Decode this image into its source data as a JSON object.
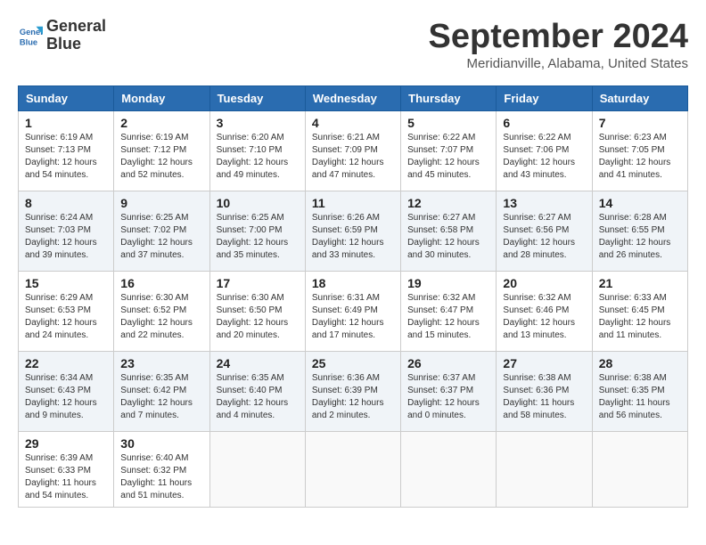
{
  "header": {
    "logo_line1": "General",
    "logo_line2": "Blue",
    "month": "September 2024",
    "location": "Meridianville, Alabama, United States"
  },
  "days_of_week": [
    "Sunday",
    "Monday",
    "Tuesday",
    "Wednesday",
    "Thursday",
    "Friday",
    "Saturday"
  ],
  "weeks": [
    [
      {
        "day": "1",
        "sunrise": "6:19 AM",
        "sunset": "7:13 PM",
        "daylight": "12 hours and 54 minutes."
      },
      {
        "day": "2",
        "sunrise": "6:19 AM",
        "sunset": "7:12 PM",
        "daylight": "12 hours and 52 minutes."
      },
      {
        "day": "3",
        "sunrise": "6:20 AM",
        "sunset": "7:10 PM",
        "daylight": "12 hours and 49 minutes."
      },
      {
        "day": "4",
        "sunrise": "6:21 AM",
        "sunset": "7:09 PM",
        "daylight": "12 hours and 47 minutes."
      },
      {
        "day": "5",
        "sunrise": "6:22 AM",
        "sunset": "7:07 PM",
        "daylight": "12 hours and 45 minutes."
      },
      {
        "day": "6",
        "sunrise": "6:22 AM",
        "sunset": "7:06 PM",
        "daylight": "12 hours and 43 minutes."
      },
      {
        "day": "7",
        "sunrise": "6:23 AM",
        "sunset": "7:05 PM",
        "daylight": "12 hours and 41 minutes."
      }
    ],
    [
      {
        "day": "8",
        "sunrise": "6:24 AM",
        "sunset": "7:03 PM",
        "daylight": "12 hours and 39 minutes."
      },
      {
        "day": "9",
        "sunrise": "6:25 AM",
        "sunset": "7:02 PM",
        "daylight": "12 hours and 37 minutes."
      },
      {
        "day": "10",
        "sunrise": "6:25 AM",
        "sunset": "7:00 PM",
        "daylight": "12 hours and 35 minutes."
      },
      {
        "day": "11",
        "sunrise": "6:26 AM",
        "sunset": "6:59 PM",
        "daylight": "12 hours and 33 minutes."
      },
      {
        "day": "12",
        "sunrise": "6:27 AM",
        "sunset": "6:58 PM",
        "daylight": "12 hours and 30 minutes."
      },
      {
        "day": "13",
        "sunrise": "6:27 AM",
        "sunset": "6:56 PM",
        "daylight": "12 hours and 28 minutes."
      },
      {
        "day": "14",
        "sunrise": "6:28 AM",
        "sunset": "6:55 PM",
        "daylight": "12 hours and 26 minutes."
      }
    ],
    [
      {
        "day": "15",
        "sunrise": "6:29 AM",
        "sunset": "6:53 PM",
        "daylight": "12 hours and 24 minutes."
      },
      {
        "day": "16",
        "sunrise": "6:30 AM",
        "sunset": "6:52 PM",
        "daylight": "12 hours and 22 minutes."
      },
      {
        "day": "17",
        "sunrise": "6:30 AM",
        "sunset": "6:50 PM",
        "daylight": "12 hours and 20 minutes."
      },
      {
        "day": "18",
        "sunrise": "6:31 AM",
        "sunset": "6:49 PM",
        "daylight": "12 hours and 17 minutes."
      },
      {
        "day": "19",
        "sunrise": "6:32 AM",
        "sunset": "6:47 PM",
        "daylight": "12 hours and 15 minutes."
      },
      {
        "day": "20",
        "sunrise": "6:32 AM",
        "sunset": "6:46 PM",
        "daylight": "12 hours and 13 minutes."
      },
      {
        "day": "21",
        "sunrise": "6:33 AM",
        "sunset": "6:45 PM",
        "daylight": "12 hours and 11 minutes."
      }
    ],
    [
      {
        "day": "22",
        "sunrise": "6:34 AM",
        "sunset": "6:43 PM",
        "daylight": "12 hours and 9 minutes."
      },
      {
        "day": "23",
        "sunrise": "6:35 AM",
        "sunset": "6:42 PM",
        "daylight": "12 hours and 7 minutes."
      },
      {
        "day": "24",
        "sunrise": "6:35 AM",
        "sunset": "6:40 PM",
        "daylight": "12 hours and 4 minutes."
      },
      {
        "day": "25",
        "sunrise": "6:36 AM",
        "sunset": "6:39 PM",
        "daylight": "12 hours and 2 minutes."
      },
      {
        "day": "26",
        "sunrise": "6:37 AM",
        "sunset": "6:37 PM",
        "daylight": "12 hours and 0 minutes."
      },
      {
        "day": "27",
        "sunrise": "6:38 AM",
        "sunset": "6:36 PM",
        "daylight": "11 hours and 58 minutes."
      },
      {
        "day": "28",
        "sunrise": "6:38 AM",
        "sunset": "6:35 PM",
        "daylight": "11 hours and 56 minutes."
      }
    ],
    [
      {
        "day": "29",
        "sunrise": "6:39 AM",
        "sunset": "6:33 PM",
        "daylight": "11 hours and 54 minutes."
      },
      {
        "day": "30",
        "sunrise": "6:40 AM",
        "sunset": "6:32 PM",
        "daylight": "11 hours and 51 minutes."
      },
      null,
      null,
      null,
      null,
      null
    ]
  ]
}
